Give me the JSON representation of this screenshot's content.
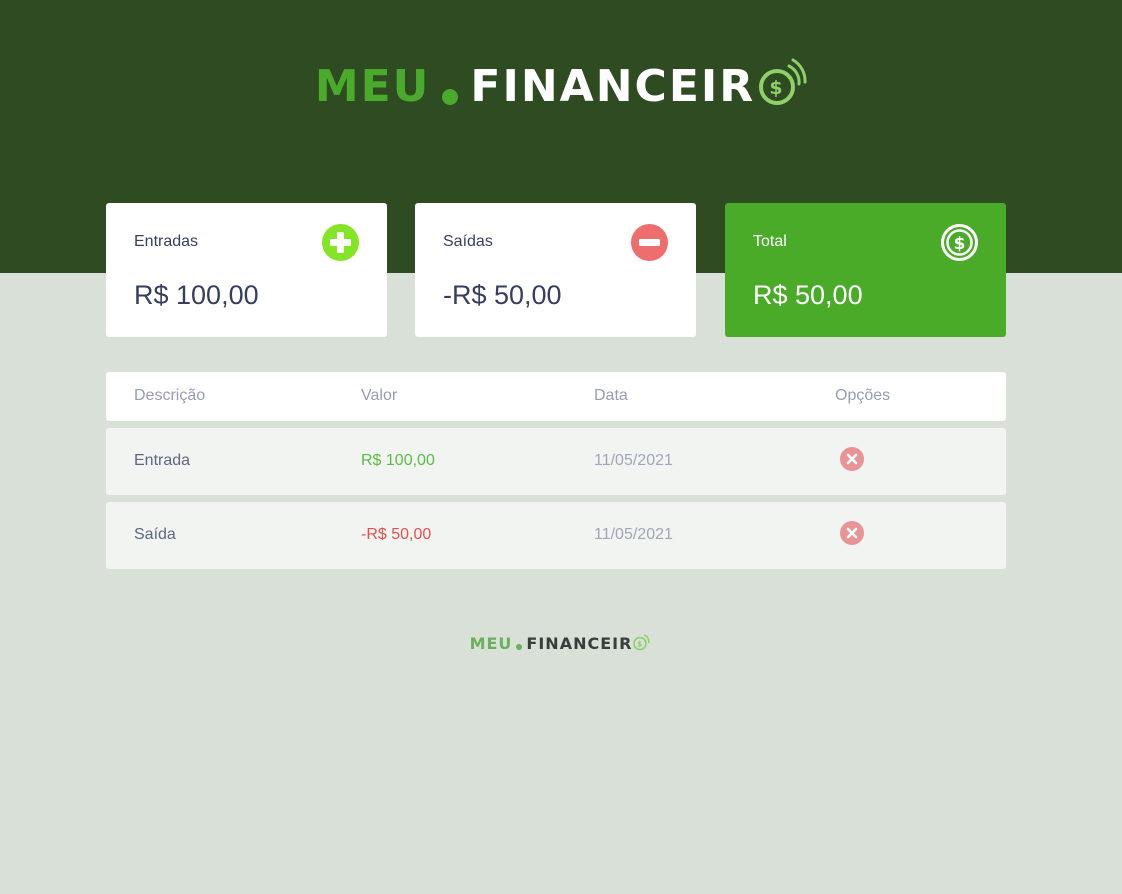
{
  "brand": {
    "part1": "MEU",
    "part2": "FINANCEIR",
    "colors": {
      "header_bg": "#2e4b22",
      "accent": "#49aa2c",
      "page_bg": "#d8e0d8"
    }
  },
  "summary": {
    "income": {
      "label": "Entradas",
      "value": "R$ 100,00",
      "icon": "plus-circle-icon"
    },
    "expense": {
      "label": "Saídas",
      "value": "-R$ 50,00",
      "icon": "minus-circle-icon"
    },
    "total": {
      "label": "Total",
      "value": "R$ 50,00",
      "icon": "dollar-circle-icon"
    }
  },
  "table": {
    "headers": [
      "Descrição",
      "Valor",
      "Data",
      "Opções"
    ],
    "rows": [
      {
        "description": "Entrada",
        "amount": "R$ 100,00",
        "date": "11/05/2021",
        "type": "income",
        "action_icon": "remove-icon"
      },
      {
        "description": "Saída",
        "amount": "-R$ 50,00",
        "date": "11/05/2021",
        "type": "expense",
        "action_icon": "remove-icon"
      }
    ]
  }
}
